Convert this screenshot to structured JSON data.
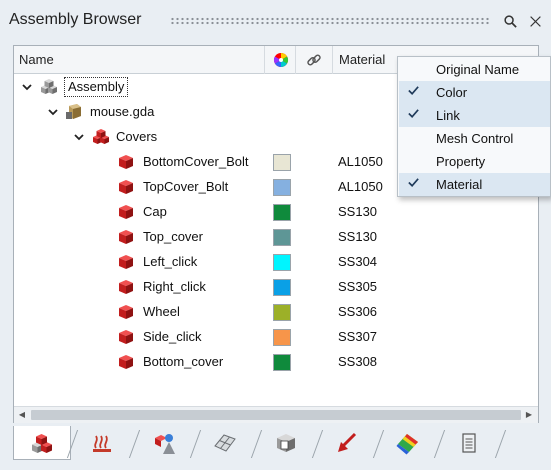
{
  "titlebar": {
    "title": "Assembly Browser",
    "search_icon": "search-icon",
    "close_icon": "close-icon"
  },
  "columns": {
    "name": "Name",
    "color_icon": "color-wheel-icon",
    "link_icon": "chain-link-icon",
    "material": "Material"
  },
  "tree": [
    {
      "label": "Assembly",
      "depth": 0,
      "icon": "assembly-icon",
      "expanded": true
    },
    {
      "label": "mouse.gda",
      "depth": 1,
      "icon": "part-file-icon",
      "expanded": true
    },
    {
      "label": "Covers",
      "depth": 2,
      "icon": "component-group-icon",
      "expanded": true
    },
    {
      "label": "BottomCover_Bolt",
      "depth": 3,
      "icon": "component-icon",
      "color": "#e8e6d4",
      "material": "AL1050"
    },
    {
      "label": "TopCover_Bolt",
      "depth": 3,
      "icon": "component-icon",
      "color": "#85b0e0",
      "material": "AL1050"
    },
    {
      "label": "Cap",
      "depth": 3,
      "icon": "component-icon",
      "color": "#0f8a3c",
      "material": "SS130"
    },
    {
      "label": "Top_cover",
      "depth": 3,
      "icon": "component-icon",
      "color": "#5e9696",
      "material": "SS130"
    },
    {
      "label": "Left_click",
      "depth": 3,
      "icon": "component-icon",
      "color": "#00f5ff",
      "material": "SS304"
    },
    {
      "label": "Right_click",
      "depth": 3,
      "icon": "component-icon",
      "color": "#0aa0e6",
      "material": "SS305"
    },
    {
      "label": "Wheel",
      "depth": 3,
      "icon": "component-icon",
      "color": "#9cb028",
      "material": "SS306"
    },
    {
      "label": "Side_click",
      "depth": 3,
      "icon": "component-icon",
      "color": "#f7954a",
      "material": "SS307"
    },
    {
      "label": "Bottom_cover",
      "depth": 3,
      "icon": "component-icon",
      "color": "#0f8a3c",
      "material": "SS308"
    }
  ],
  "column_menu": [
    {
      "label": "Original Name",
      "checked": false
    },
    {
      "label": "Color",
      "checked": true
    },
    {
      "label": "Link",
      "checked": true
    },
    {
      "label": "Mesh Control",
      "checked": false
    },
    {
      "label": "Property",
      "checked": false
    },
    {
      "label": "Material",
      "checked": true
    }
  ],
  "bottom_tabs": [
    {
      "name": "tab-assembly",
      "icon": "assembly-cubes-icon",
      "active": true
    },
    {
      "name": "tab-thermal",
      "icon": "heat-waves-icon",
      "active": false
    },
    {
      "name": "tab-connectors",
      "icon": "connector-icon",
      "active": false
    },
    {
      "name": "tab-surfaces",
      "icon": "surface-icon",
      "active": false
    },
    {
      "name": "tab-properties",
      "icon": "property-cube-icon",
      "active": false
    },
    {
      "name": "tab-loads",
      "icon": "load-arrow-icon",
      "active": false
    },
    {
      "name": "tab-results",
      "icon": "contour-icon",
      "active": false
    },
    {
      "name": "tab-scripts",
      "icon": "scroll-icon",
      "active": false
    }
  ],
  "colors": {
    "check": "#1f3a5a",
    "checked_bg": "#dbe7f2",
    "part_red": "#d42a2a"
  }
}
